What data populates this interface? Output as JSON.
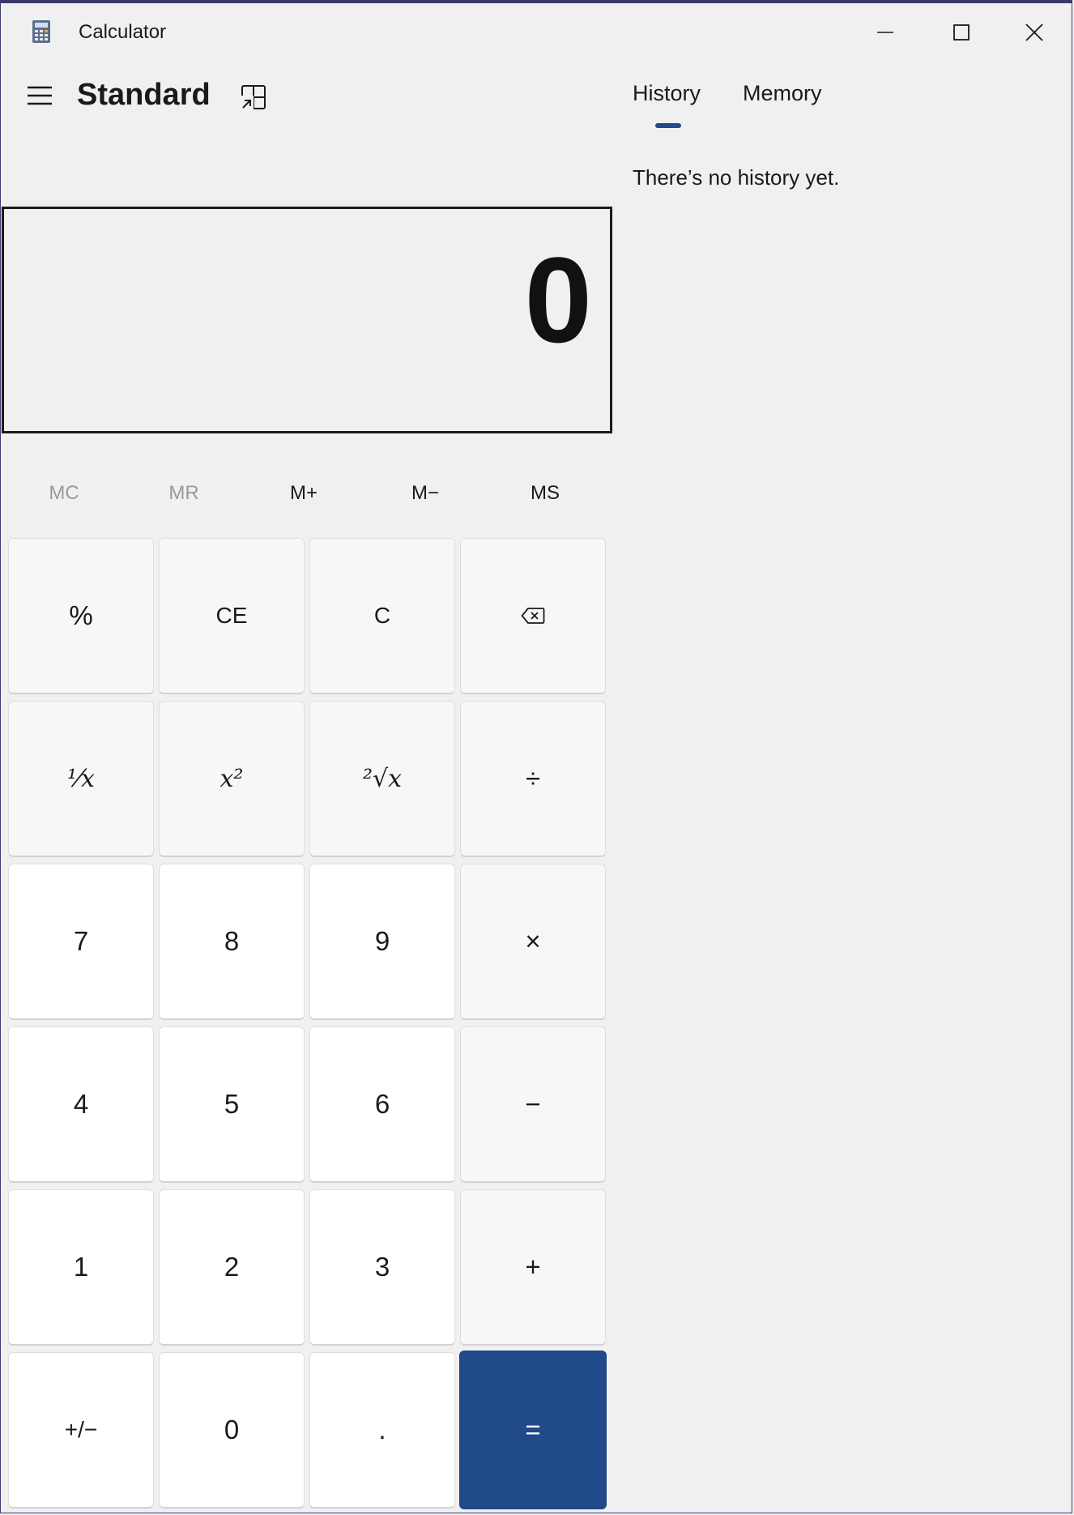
{
  "window": {
    "title": "Calculator"
  },
  "header": {
    "mode_title": "Standard"
  },
  "tabs": [
    {
      "label": "History",
      "active": true
    },
    {
      "label": "Memory",
      "active": false
    }
  ],
  "history": {
    "empty_message": "There’s no history yet."
  },
  "display": {
    "value": "0"
  },
  "memory_buttons": [
    {
      "label": "MC",
      "enabled": false
    },
    {
      "label": "MR",
      "enabled": false
    },
    {
      "label": "M+",
      "enabled": true
    },
    {
      "label": "M−",
      "enabled": true
    },
    {
      "label": "MS",
      "enabled": true
    }
  ],
  "keys": {
    "percent": "%",
    "ce": "CE",
    "c": "C",
    "reciprocal": "⅟x",
    "square": "x²",
    "sqrt": "²√x",
    "divide": "÷",
    "seven": "7",
    "eight": "8",
    "nine": "9",
    "multiply": "×",
    "four": "4",
    "five": "5",
    "six": "6",
    "minus": "−",
    "one": "1",
    "two": "2",
    "three": "3",
    "plus": "+",
    "negate": "+/−",
    "zero": "0",
    "decimal": ".",
    "equals": "="
  },
  "colors": {
    "accent": "#214a8a",
    "background": "#f0f0f0",
    "number_key": "#ffffff",
    "operator_key": "#f7f7f7",
    "disabled_text": "#9a9a9a"
  },
  "icons": {
    "app": "calculator-icon",
    "minimize": "minimize-icon",
    "maximize": "maximize-icon",
    "close": "close-icon",
    "menu": "hamburger-menu-icon",
    "keep_on_top": "keep-on-top-icon",
    "backspace": "backspace-icon"
  }
}
